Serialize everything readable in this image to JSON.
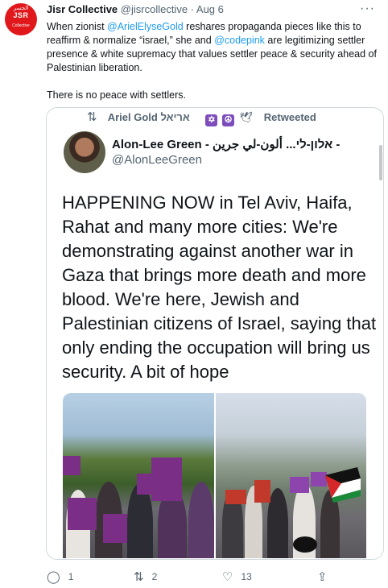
{
  "author": {
    "name": "Jisr Collective",
    "handle": "@jisrcollective",
    "date": "· Aug 6",
    "avatar_text": "JSR",
    "avatar_arabic": "الجسر",
    "avatar_small": "Collective"
  },
  "tweet": {
    "line1_pre": "When zionist ",
    "mention1": "@ArielElyseGold",
    "line1_mid": " reshares propaganda pieces like this to reaffirm & normalize “israel,” she and ",
    "mention2": "@codepink",
    "line1_post": " are legitimizing settler presence & white supremacy that values settler peace & security ahead of Palestinian liberation.",
    "line2": "There is no peace with settlers."
  },
  "retweet": {
    "name": "Ariel Gold אריאל",
    "label": "Retweeted"
  },
  "quoted": {
    "name": "Alon-Lee Green - אלון-לי... ألون-لي جرين -",
    "handle": "@AlonLeeGreen",
    "text": "HAPPENING NOW in Tel Aviv, Haifa, Rahat and many more cities: We're demonstrating against another war in Gaza that brings more death and more blood. We're here, Jewish and Palestinian citizens of Israel, saying that only ending the occupation will bring us security. A bit of hope"
  },
  "actions": {
    "replies": "1",
    "retweets": "2",
    "likes": "13"
  },
  "colors": {
    "link": "#1d9bf0",
    "muted": "#536471",
    "brand": "#e0171b",
    "sign": "#7b2e86"
  },
  "icons": [
    "more-icon",
    "retweet-icon",
    "reply-icon",
    "like-icon",
    "share-icon"
  ]
}
